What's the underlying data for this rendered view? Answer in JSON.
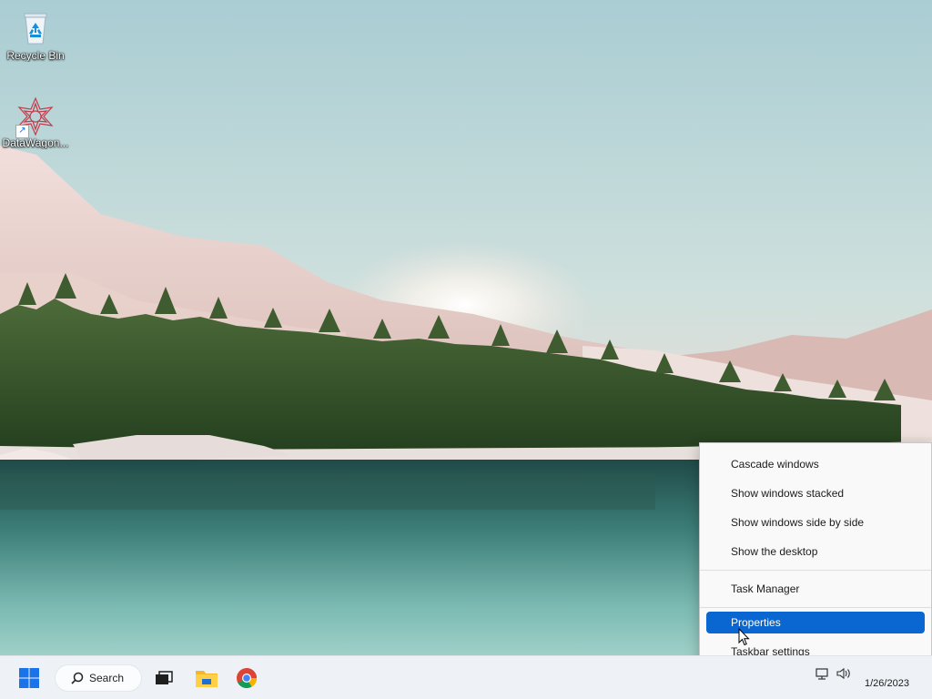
{
  "desktop": {
    "icons": [
      {
        "label": "Recycle Bin",
        "icon": "recycle-bin-icon"
      },
      {
        "label": "DataWagon...",
        "icon": "datawagon-shortcut-icon"
      }
    ]
  },
  "context_menu": {
    "items": [
      {
        "label": "Cascade windows"
      },
      {
        "label": "Show windows stacked"
      },
      {
        "label": "Show windows side by side"
      },
      {
        "label": "Show the desktop"
      },
      {
        "label": "Task Manager"
      },
      {
        "label": "Properties",
        "highlighted": true
      },
      {
        "label": "Taskbar settings"
      }
    ]
  },
  "taskbar": {
    "search_label": "Search",
    "pinned": [
      {
        "name": "start-icon"
      },
      {
        "name": "task-view-icon"
      },
      {
        "name": "file-explorer-icon"
      },
      {
        "name": "chrome-icon"
      }
    ],
    "date": "1/26/2023"
  },
  "colors": {
    "menu_highlight": "#0a67d2",
    "taskbar_bg": "#eef1f5",
    "start_blue": "#1a73e8"
  }
}
